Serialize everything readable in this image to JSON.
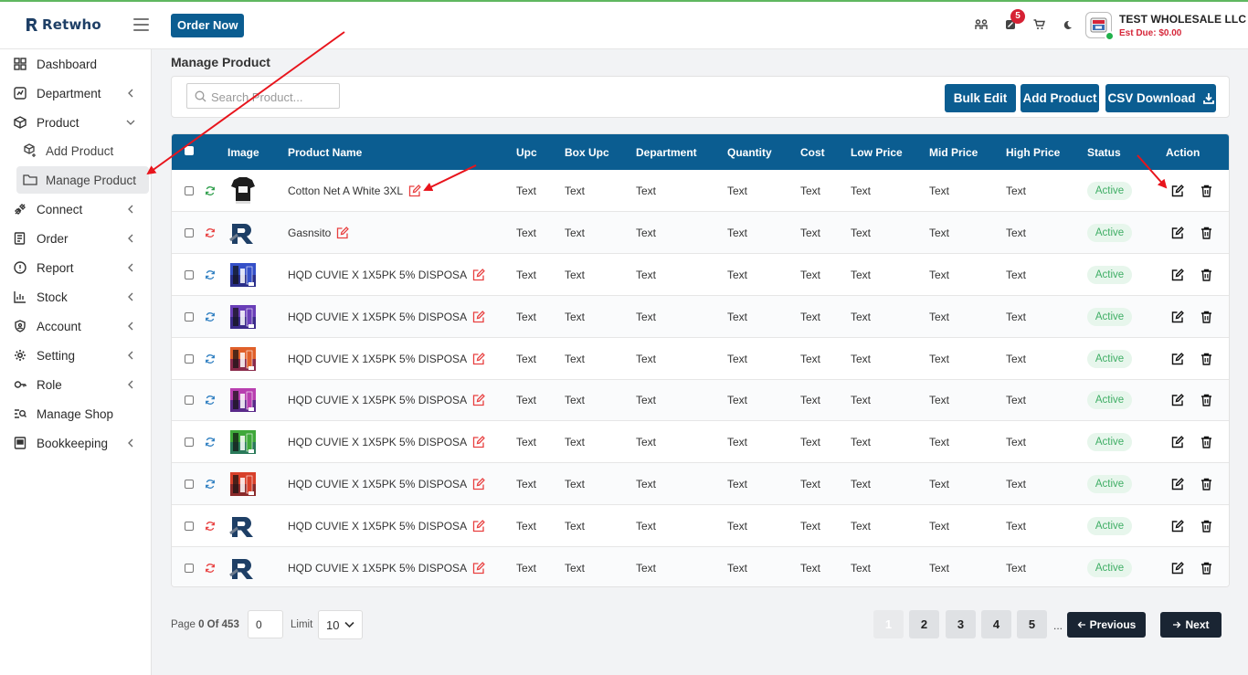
{
  "brand": {
    "name": "Retwho"
  },
  "header": {
    "order_now": "Order Now",
    "notification_count": "5",
    "company_name": "TEST WHOLESALE LLC",
    "est_due": "Est Due: $0.00",
    "icons": [
      "users-icon",
      "tag-icon",
      "cart-icon",
      "moon-icon"
    ]
  },
  "sidebar": {
    "items": [
      {
        "label": "Dashboard",
        "icon": "grid-icon"
      },
      {
        "label": "Department",
        "icon": "department-icon"
      },
      {
        "label": "Product",
        "icon": "box-icon"
      },
      {
        "label": "Add Product",
        "icon": "box-plus-icon"
      },
      {
        "label": "Manage Product",
        "icon": "folder-icon"
      },
      {
        "label": "Connect",
        "icon": "plug-icon"
      },
      {
        "label": "Order",
        "icon": "order-icon"
      },
      {
        "label": "Report",
        "icon": "info-icon"
      },
      {
        "label": "Stock",
        "icon": "chart-icon"
      },
      {
        "label": "Account",
        "icon": "shield-icon"
      },
      {
        "label": "Setting",
        "icon": "gear-icon"
      },
      {
        "label": "Role",
        "icon": "key-icon"
      },
      {
        "label": "Manage Shop",
        "icon": "shop-search-icon"
      },
      {
        "label": "Bookkeeping",
        "icon": "book-icon"
      }
    ]
  },
  "page": {
    "title": "Manage Product"
  },
  "toolbar": {
    "search_placeholder": "Search Product...",
    "bulk_edit": "Bulk Edit",
    "add_product": "Add Product",
    "csv_download": "CSV Download"
  },
  "table": {
    "headers": [
      "Image",
      "Product Name",
      "Upc",
      "Box Upc",
      "Department",
      "Quantity",
      "Cost",
      "Low Price",
      "Mid Price",
      "High Price",
      "Status",
      "Action"
    ],
    "rows": [
      {
        "name": "Cotton Net A White 3XL",
        "upc": "Text",
        "box_upc": "Text",
        "department": "Text",
        "quantity": "Text",
        "cost": "Text",
        "low": "Text",
        "mid": "Text",
        "high": "Text",
        "status": "Active",
        "sync": "green",
        "thumb": "shirt"
      },
      {
        "name": "Gasnsito",
        "upc": "Text",
        "box_upc": "Text",
        "department": "Text",
        "quantity": "Text",
        "cost": "Text",
        "low": "Text",
        "mid": "Text",
        "high": "Text",
        "status": "Active",
        "sync": "red",
        "thumb": "logo"
      },
      {
        "name": "HQD CUVIE X 1X5PK 5% DISPOSA",
        "upc": "Text",
        "box_upc": "Text",
        "department": "Text",
        "quantity": "Text",
        "cost": "Text",
        "low": "Text",
        "mid": "Text",
        "high": "Text",
        "status": "Active",
        "sync": "blue",
        "thumb": "blue"
      },
      {
        "name": "HQD CUVIE X 1X5PK 5% DISPOSA",
        "upc": "Text",
        "box_upc": "Text",
        "department": "Text",
        "quantity": "Text",
        "cost": "Text",
        "low": "Text",
        "mid": "Text",
        "high": "Text",
        "status": "Active",
        "sync": "blue",
        "thumb": "purple"
      },
      {
        "name": "HQD CUVIE X 1X5PK 5% DISPOSA",
        "upc": "Text",
        "box_upc": "Text",
        "department": "Text",
        "quantity": "Text",
        "cost": "Text",
        "low": "Text",
        "mid": "Text",
        "high": "Text",
        "status": "Active",
        "sync": "blue",
        "thumb": "orange"
      },
      {
        "name": "HQD CUVIE X 1X5PK 5% DISPOSA",
        "upc": "Text",
        "box_upc": "Text",
        "department": "Text",
        "quantity": "Text",
        "cost": "Text",
        "low": "Text",
        "mid": "Text",
        "high": "Text",
        "status": "Active",
        "sync": "blue",
        "thumb": "magenta"
      },
      {
        "name": "HQD CUVIE X 1X5PK 5% DISPOSA",
        "upc": "Text",
        "box_upc": "Text",
        "department": "Text",
        "quantity": "Text",
        "cost": "Text",
        "low": "Text",
        "mid": "Text",
        "high": "Text",
        "status": "Active",
        "sync": "blue",
        "thumb": "green"
      },
      {
        "name": "HQD CUVIE X 1X5PK 5% DISPOSA",
        "upc": "Text",
        "box_upc": "Text",
        "department": "Text",
        "quantity": "Text",
        "cost": "Text",
        "low": "Text",
        "mid": "Text",
        "high": "Text",
        "status": "Active",
        "sync": "blue",
        "thumb": "red"
      },
      {
        "name": "HQD CUVIE X 1X5PK 5% DISPOSA",
        "upc": "Text",
        "box_upc": "Text",
        "department": "Text",
        "quantity": "Text",
        "cost": "Text",
        "low": "Text",
        "mid": "Text",
        "high": "Text",
        "status": "Active",
        "sync": "red",
        "thumb": "logo"
      },
      {
        "name": "HQD CUVIE X 1X5PK 5% DISPOSA",
        "upc": "Text",
        "box_upc": "Text",
        "department": "Text",
        "quantity": "Text",
        "cost": "Text",
        "low": "Text",
        "mid": "Text",
        "high": "Text",
        "status": "Active",
        "sync": "red",
        "thumb": "logo"
      }
    ]
  },
  "pagination": {
    "page_label": "Page",
    "page_current": "0",
    "page_of": "Of",
    "page_total": "453",
    "page_input_value": "0",
    "limit_label": "Limit",
    "limit_value": "10",
    "pages": [
      "1",
      "2",
      "3",
      "4",
      "5"
    ],
    "ellipsis": "...",
    "previous": "Previous",
    "next": "Next"
  },
  "colors": {
    "primary": "#0b5d91",
    "active_green": "#3fae65",
    "badge_red": "#d62134",
    "annotation_red": "#e8141c",
    "dark_button": "#1a2533"
  }
}
